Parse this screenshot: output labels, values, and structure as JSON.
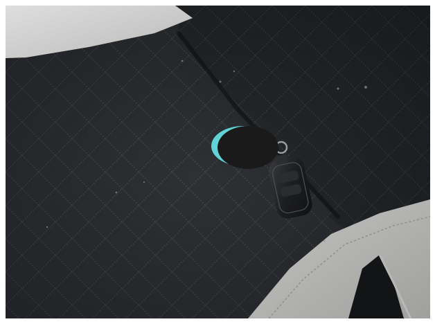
{
  "photo": {
    "subject": "car-seat-with-key-fob",
    "colors": {
      "upholstery": "#2e3034",
      "upholstery_dark": "#1f2124",
      "quilt_stitch": "#4a4d52",
      "leather_light": "#c9c9c7",
      "leather_mid": "#a9aaa8",
      "fob_body": "#1c1d1f",
      "tag_cap": "#5fd3d6",
      "tag_body": "#1a1a1a",
      "key_ring": "#9a9c9e"
    }
  }
}
